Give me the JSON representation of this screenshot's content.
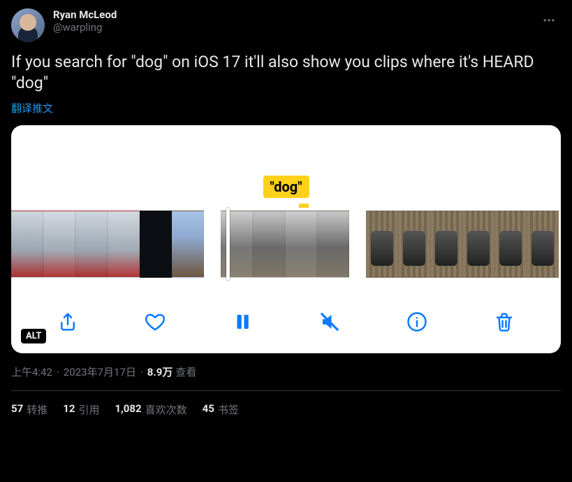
{
  "author": {
    "display_name": "Ryan McLeod",
    "handle": "@warpling"
  },
  "tweet_text": "If you search for \"dog\" on iOS 17 it'll also show you clips where it's HEARD \"dog\"",
  "translate_label": "翻译推文",
  "media": {
    "search_label": "\"dog\"",
    "alt_badge": "ALT"
  },
  "meta": {
    "time": "上午4:42",
    "date": "2023年7月17日",
    "views_number": "8.9万",
    "views_label": "查看"
  },
  "stats": {
    "retweets_num": "57",
    "retweets_label": "转推",
    "quotes_num": "12",
    "quotes_label": "引用",
    "likes_num": "1,082",
    "likes_label": "喜欢次数",
    "bookmarks_num": "45",
    "bookmarks_label": "书签"
  }
}
